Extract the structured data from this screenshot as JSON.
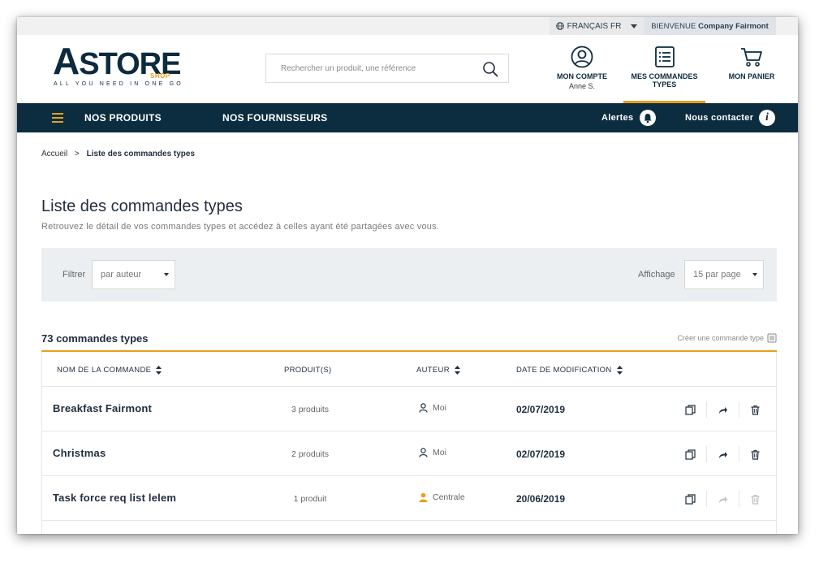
{
  "topbar": {
    "language": "FRANÇAIS FR",
    "welcome_prefix": "BIENVENUE",
    "welcome_company": "Company Fairmont"
  },
  "logo": {
    "name_initial": "A",
    "name_rest": "STORE",
    "shop": "SHOP",
    "tagline": "ALL YOU NEED IN ONE GO"
  },
  "search": {
    "placeholder": "Rechercher un produit, une référence"
  },
  "header_nav": {
    "account_label": "MON COMPTE",
    "account_user": "Anne S.",
    "orders_label": "MES COMMANDES TYPES",
    "cart_label": "MON PANIER"
  },
  "navbar": {
    "products": "NOS PRODUITS",
    "suppliers": "NOS FOURNISSEURS",
    "alerts": "Alertes",
    "contact": "Nous contacter"
  },
  "breadcrumb": {
    "home": "Accueil",
    "separator": ">",
    "current": "Liste des commandes types"
  },
  "page": {
    "title": "Liste des commandes types",
    "subtitle": "Retrouvez le détail de vos commandes types et accédez à celles ayant été partagées avec vous."
  },
  "filters": {
    "filter_label": "Filtrer",
    "filter_value": "par auteur",
    "display_label": "Affichage",
    "display_value": "15 par page"
  },
  "list": {
    "count": "73 commandes types",
    "create_label": "Créer une commande type",
    "columns": {
      "name": "NOM DE LA COMMANDE",
      "products": "PRODUIT(S)",
      "author": "AUTEUR",
      "date": "DATE DE MODIFICATION"
    },
    "rows": [
      {
        "name": "Breakfast Fairmont",
        "products": "3 produits",
        "author": "Moi",
        "date": "02/07/2019"
      },
      {
        "name": "Christmas",
        "products": "2 produits",
        "author": "Moi",
        "date": "02/07/2019"
      },
      {
        "name": "Task force req list lelem",
        "products": "1 produit",
        "author": "Centrale",
        "date": "20/06/2019"
      }
    ]
  },
  "colors": {
    "navy": "#0b2d3f",
    "accent": "#e6a01b",
    "filter_bg": "#eceff1"
  },
  "icons": {
    "globe": "globe-icon",
    "search": "search-icon",
    "account": "user-circle-icon",
    "orders": "list-icon",
    "cart": "cart-icon",
    "menu": "hamburger-icon",
    "bell": "bell-icon",
    "info": "info-icon",
    "sort": "sort-icon",
    "user": "user-icon",
    "copy": "copy-icon",
    "share": "share-icon",
    "delete": "trash-icon"
  }
}
